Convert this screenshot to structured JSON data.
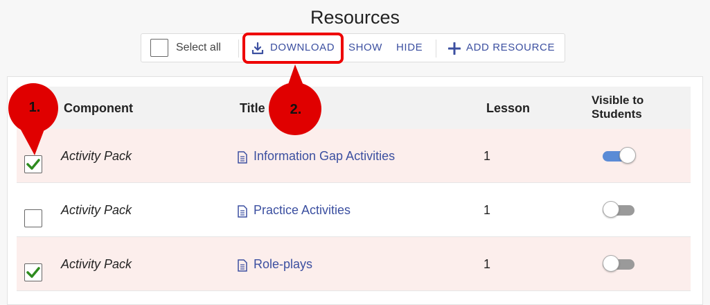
{
  "page": {
    "title": "Resources"
  },
  "toolbar": {
    "select_all_label": "Select all",
    "download_label": "DOWNLOAD",
    "show_label": "SHOW",
    "hide_label": "HIDE",
    "add_resource_label": "ADD RESOURCE"
  },
  "table": {
    "headers": {
      "component": "Component",
      "title": "Title",
      "lesson": "Lesson",
      "visible_line1": "Visible to",
      "visible_line2": "Students"
    },
    "rows": [
      {
        "component": "Activity Pack",
        "title": "Information Gap Activities",
        "lesson": "1",
        "checked": true,
        "visible": true
      },
      {
        "component": "Activity Pack",
        "title": "Practice Activities",
        "lesson": "1",
        "checked": false,
        "visible": false
      },
      {
        "component": "Activity Pack",
        "title": "Role-plays",
        "lesson": "1",
        "checked": true,
        "visible": false
      }
    ]
  },
  "annotations": {
    "callout_1": "1.",
    "callout_2": "2."
  },
  "colors": {
    "accent": "#3b4fa0",
    "toggle_on": "#5b8bd6",
    "toggle_off": "#9a9a9a",
    "check": "#2e8b1e",
    "callout": "#e00000",
    "selected_row": "#fceeec"
  },
  "icons": {
    "download": "download-icon",
    "add": "plus-icon",
    "document": "document-icon",
    "check": "check-icon"
  }
}
